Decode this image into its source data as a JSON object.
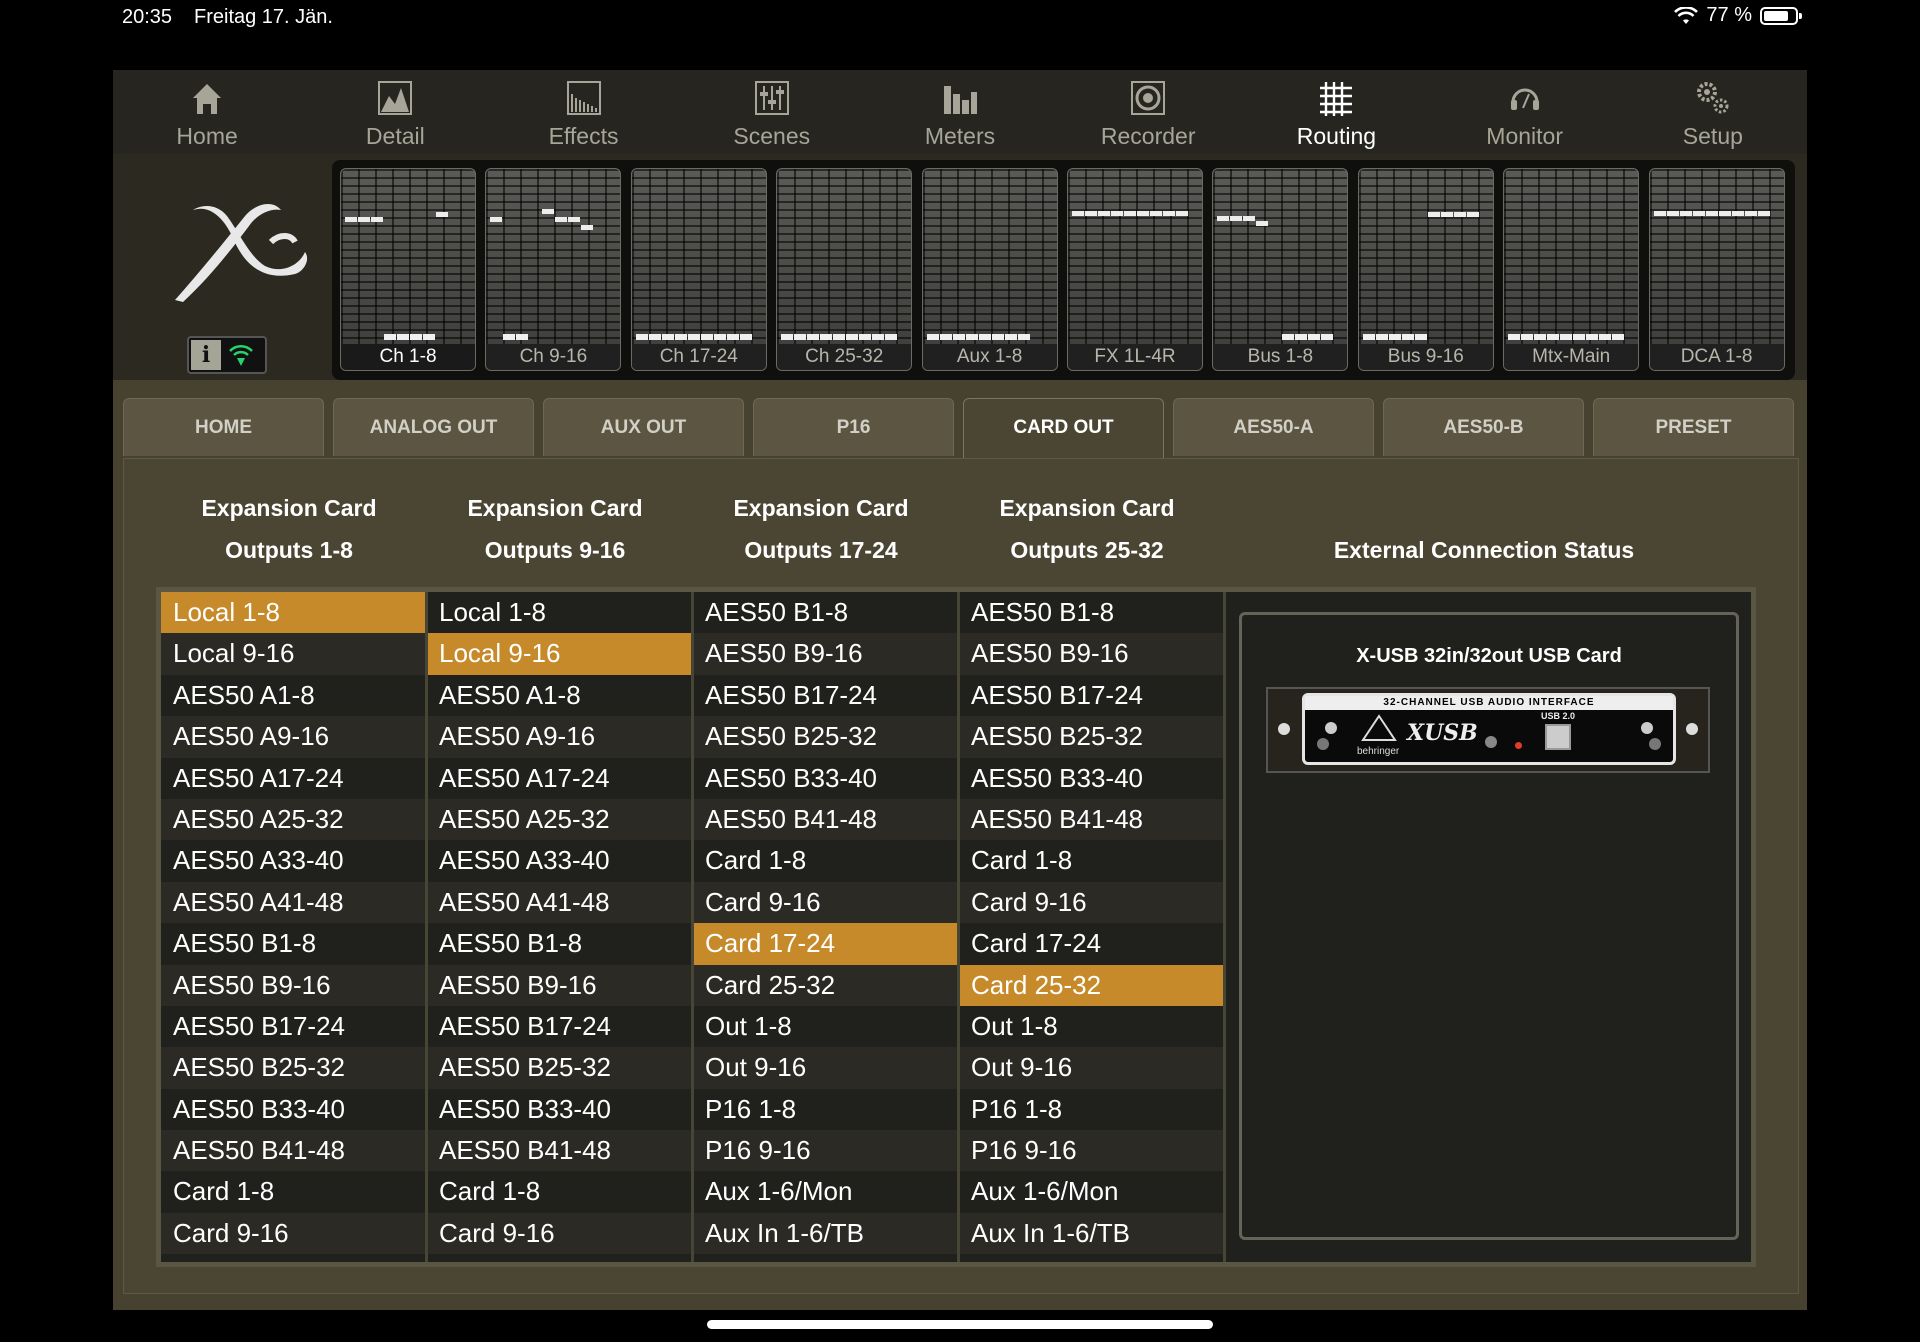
{
  "status_bar": {
    "time": "20:35",
    "date": "Freitag 17. Jän.",
    "battery": "77 %",
    "battery_level": 0.77
  },
  "nav": {
    "items": [
      {
        "label": "Home",
        "icon": "home-icon"
      },
      {
        "label": "Detail",
        "icon": "detail-icon"
      },
      {
        "label": "Effects",
        "icon": "effects-icon"
      },
      {
        "label": "Scenes",
        "icon": "scenes-icon"
      },
      {
        "label": "Meters",
        "icon": "meters-icon"
      },
      {
        "label": "Recorder",
        "icon": "recorder-icon"
      },
      {
        "label": "Routing",
        "icon": "routing-icon"
      },
      {
        "label": "Monitor",
        "icon": "monitor-icon"
      },
      {
        "label": "Setup",
        "icon": "setup-icon"
      }
    ],
    "active": "Routing"
  },
  "header": {
    "info_button": "i"
  },
  "strips": [
    "Ch 1-8",
    "Ch 9-16",
    "Ch 17-24",
    "Ch 25-32",
    "Aux 1-8",
    "FX 1L-4R",
    "Bus 1-8",
    "Bus 9-16",
    "Mtx-Main",
    "DCA 1-8"
  ],
  "tabs": [
    "HOME",
    "ANALOG OUT",
    "AUX OUT",
    "P16",
    "CARD OUT",
    "AES50-A",
    "AES50-B",
    "PRESET"
  ],
  "active_tab": "CARD OUT",
  "columns": [
    {
      "line1": "Expansion Card",
      "line2": "Outputs 1-8"
    },
    {
      "line1": "Expansion Card",
      "line2": "Outputs 9-16"
    },
    {
      "line1": "Expansion Card",
      "line2": "Outputs 17-24"
    },
    {
      "line1": "Expansion Card",
      "line2": "Outputs 25-32"
    },
    {
      "line1": "",
      "line2": "External Connection Status"
    }
  ],
  "lists": [
    [
      "Local 1-8",
      "Local 9-16",
      "AES50 A1-8",
      "AES50 A9-16",
      "AES50 A17-24",
      "AES50 A25-32",
      "AES50 A33-40",
      "AES50 A41-48",
      "AES50 B1-8",
      "AES50 B9-16",
      "AES50 B17-24",
      "AES50 B25-32",
      "AES50 B33-40",
      "AES50 B41-48",
      "Card 1-8",
      "Card 9-16"
    ],
    [
      "Local 1-8",
      "Local 9-16",
      "AES50 A1-8",
      "AES50 A9-16",
      "AES50 A17-24",
      "AES50 A25-32",
      "AES50 A33-40",
      "AES50 A41-48",
      "AES50 B1-8",
      "AES50 B9-16",
      "AES50 B17-24",
      "AES50 B25-32",
      "AES50 B33-40",
      "AES50 B41-48",
      "Card 1-8",
      "Card 9-16"
    ],
    [
      "AES50 B1-8",
      "AES50 B9-16",
      "AES50 B17-24",
      "AES50 B25-32",
      "AES50 B33-40",
      "AES50 B41-48",
      "Card 1-8",
      "Card 9-16",
      "Card 17-24",
      "Card 25-32",
      "Out 1-8",
      "Out 9-16",
      "P16 1-8",
      "P16 9-16",
      "Aux 1-6/Mon",
      "Aux In 1-6/TB"
    ],
    [
      "AES50 B1-8",
      "AES50 B9-16",
      "AES50 B17-24",
      "AES50 B25-32",
      "AES50 B33-40",
      "AES50 B41-48",
      "Card 1-8",
      "Card 9-16",
      "Card 17-24",
      "Card 25-32",
      "Out 1-8",
      "Out 9-16",
      "P16 1-8",
      "P16 9-16",
      "Aux 1-6/Mon",
      "Aux In 1-6/TB"
    ]
  ],
  "selected": [
    "Local 1-8",
    "Local 9-16",
    "Card 17-24",
    "Card 25-32"
  ],
  "card": {
    "title": "X-USB 32in/32out USB Card",
    "strip_text": "32-CHANNEL USB AUDIO INTERFACE",
    "usb_label": "USB 2.0",
    "brand": "behringer",
    "logo": "XUSB"
  },
  "colors": {
    "selected": "#c68a2a",
    "panel": "#4b4633",
    "list_bg": "#20201d"
  }
}
